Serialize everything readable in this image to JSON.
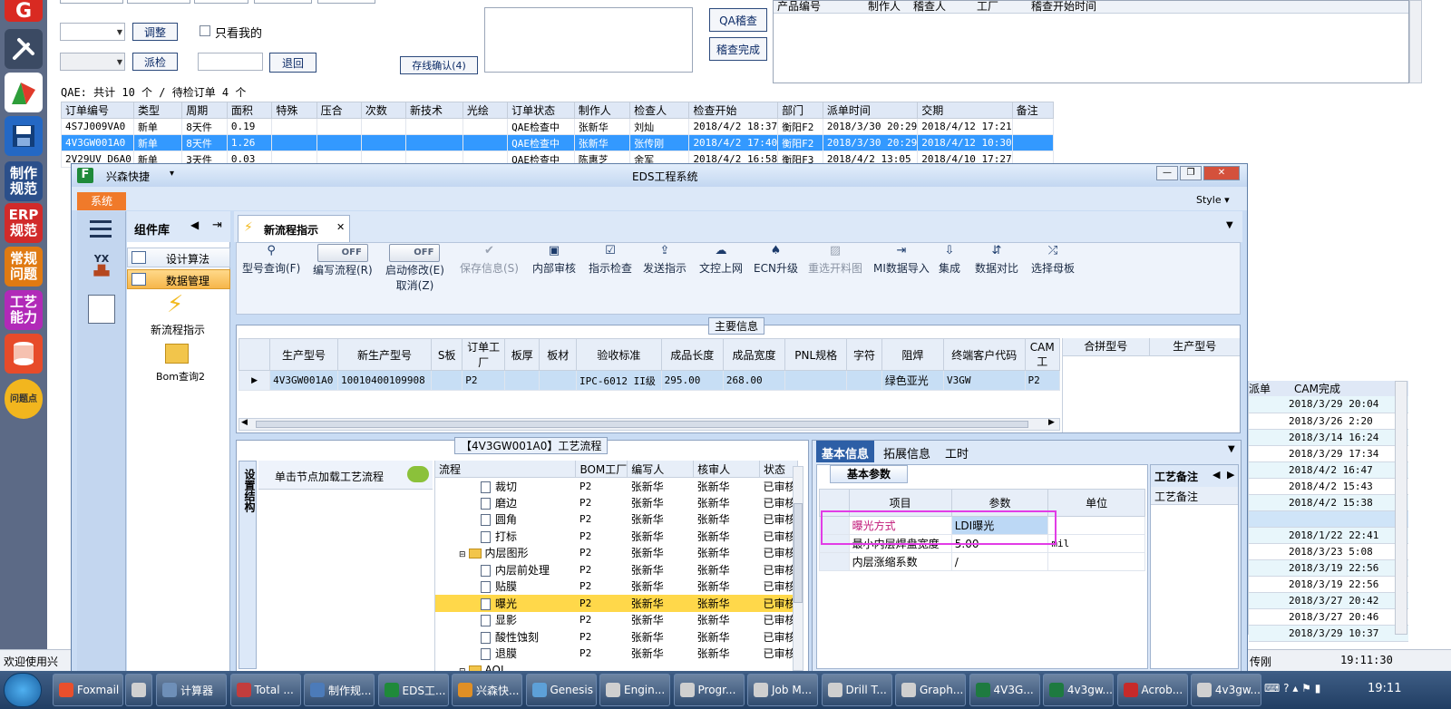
{
  "launcher": {
    "items": [
      {
        "label": "制作\n规范",
        "color": "#2b4f8a"
      },
      {
        "label": "ERP\n规范",
        "color": "#d12a2a"
      },
      {
        "label": "常规\n问题",
        "color": "#e07a12"
      },
      {
        "label": "工艺\n能力",
        "color": "#b12ab8"
      },
      {
        "label": "问题点",
        "color": "#f2b61e"
      }
    ]
  },
  "bg": {
    "toolbar": {
      "adjust_label": "调整",
      "only_mine_label": "只看我的",
      "dispatch_label": "派检",
      "return_label": "退回",
      "stock_confirm_label": "存线确认(4)",
      "qa_check_label": "QA稽查",
      "check_done_label": "稽查完成"
    },
    "qa_grid_headers": [
      "产品编号",
      "制作人",
      "稽查人",
      "工厂",
      "稽查开始时间"
    ],
    "summary": "QAE: 共计 10 个 / 待检订单 4 个",
    "orders": {
      "headers": [
        "订单编号",
        "类型",
        "周期",
        "面积",
        "特殊",
        "压合",
        "次数",
        "新技术",
        "光绘",
        "订单状态",
        "制作人",
        "检查人",
        "检查开始",
        "部门",
        "派单时间",
        "交期",
        "备注"
      ],
      "rows": [
        [
          "4S7J009VA0",
          "新单",
          "8天件",
          "0.19",
          "",
          "",
          "",
          "",
          "",
          "QAE检查中",
          "张新华",
          "刘灿",
          "2018/4/2 18:37",
          "衡阳F2",
          "2018/3/30 20:29",
          "2018/4/12 17:21",
          ""
        ],
        [
          "4V3GW001A0",
          "新单",
          "8天件",
          "1.26",
          "",
          "",
          "",
          "",
          "",
          "QAE检查中",
          "张新华",
          "张传刚",
          "2018/4/2 17:40",
          "衡阳F2",
          "2018/3/30 20:29",
          "2018/4/12 10:30",
          ""
        ],
        [
          "2V29UV D6A0",
          "新单",
          "3天件",
          "0.03",
          "",
          "",
          "",
          "",
          "",
          "QAE检查中",
          "陈惠芝",
          "余军",
          "2018/4/2 16:58",
          "衡阳F3",
          "2018/4/2 13:05",
          "2018/4/10 17:27",
          ""
        ]
      ]
    },
    "cam": {
      "header_left": "派单",
      "header": "CAM完成",
      "values": [
        "2018/3/29 20:04",
        "2018/3/26 2:20",
        "2018/3/14 16:24",
        "2018/3/29 17:34",
        "2018/4/2 16:47",
        "2018/4/2 15:43",
        "2018/4/2 15:38",
        "",
        "2018/1/22 22:41",
        "2018/3/23 5:08",
        "2018/3/19 22:56",
        "2018/3/19 22:56",
        "2018/3/27 20:42",
        "2018/3/27 20:46",
        "2018/3/29 10:37"
      ]
    },
    "status_left": "欢迎使用兴",
    "status_right_name": "传刚",
    "status_time": "19:11:30"
  },
  "eds": {
    "app_name": "兴森快捷",
    "title": "EDS工程系统",
    "system_tab": "系统",
    "style_label": "Style",
    "sidebar": {
      "component_lib": "组件库",
      "design_algo": "设计算法",
      "data_mgmt": "数据管理",
      "new_flow": "新流程指示",
      "bom_query": "Bom查询2"
    },
    "doc_tab": "新流程指示",
    "toolbar": [
      {
        "label": "型号查询(F)",
        "icon": "search-icon",
        "glyph": "⚲"
      },
      {
        "label": "编写流程(R)",
        "icon": "toggle",
        "toggle": "OFF"
      },
      {
        "label": "启动修改(E)",
        "sub": "取消(Z)",
        "icon": "toggle",
        "toggle": "OFF"
      },
      {
        "label": "保存信息(S)",
        "icon": "check-icon",
        "glyph": "✔",
        "disabled": true
      },
      {
        "label": "内部审核",
        "icon": "printer-icon",
        "glyph": "▣"
      },
      {
        "label": "指示检查",
        "icon": "checkbox-icon",
        "glyph": "☑"
      },
      {
        "label": "发送指示",
        "icon": "upload-icon",
        "glyph": "⇪"
      },
      {
        "label": "文控上网",
        "icon": "cloud-upload-icon",
        "glyph": "☁"
      },
      {
        "label": "ECN升级",
        "icon": "ecn-icon",
        "glyph": "♠"
      },
      {
        "label": "重选开料图",
        "icon": "image-icon",
        "glyph": "▨",
        "disabled": true
      },
      {
        "label": "MI数据导入",
        "icon": "import-icon",
        "glyph": "⇥"
      },
      {
        "label": "集成",
        "icon": "download-icon",
        "glyph": "⇩"
      },
      {
        "label": "数据对比",
        "icon": "compare-icon",
        "glyph": "⇵"
      },
      {
        "label": "选择母板",
        "icon": "shuffle-icon",
        "glyph": "⤮"
      }
    ],
    "main_info": {
      "legend": "主要信息",
      "headers": [
        "生产型号",
        "新生产型号",
        "S板",
        "订单工厂",
        "板厚",
        "板材",
        "验收标准",
        "成品长度",
        "成品宽度",
        "PNL规格",
        "字符",
        "阻焊",
        "终端客户代码",
        "CAM工"
      ],
      "row": [
        "4V3GW001A0",
        "10010400109908",
        "",
        "P2",
        "",
        "",
        "IPC-6012 II级",
        "295.00",
        "268.00",
        "",
        "",
        "绿色亚光",
        "V3GW",
        "P2"
      ],
      "merge_headers": [
        "合拼型号",
        "生产型号"
      ]
    },
    "flow": {
      "legend": "【4V3GW001A0】工艺流程",
      "side_tab": "设置结构",
      "load_hint": "单击节点加载工艺流程",
      "headers": [
        "流程",
        "BOM工厂",
        "编写人",
        "核审人",
        "状态"
      ],
      "rows": [
        {
          "name": "裁切",
          "type": "file",
          "indent": 2,
          "factory": "P2",
          "writer": "张新华",
          "reviewer": "张新华",
          "status": "已审核"
        },
        {
          "name": "磨边",
          "type": "file",
          "indent": 2,
          "factory": "P2",
          "writer": "张新华",
          "reviewer": "张新华",
          "status": "已审核"
        },
        {
          "name": "圆角",
          "type": "file",
          "indent": 2,
          "factory": "P2",
          "writer": "张新华",
          "reviewer": "张新华",
          "status": "已审核"
        },
        {
          "name": "打标",
          "type": "file",
          "indent": 2,
          "factory": "P2",
          "writer": "张新华",
          "reviewer": "张新华",
          "status": "已审核"
        },
        {
          "name": "内层图形",
          "type": "folder",
          "indent": 1,
          "factory": "P2",
          "writer": "张新华",
          "reviewer": "张新华",
          "status": "已审核"
        },
        {
          "name": "内层前处理",
          "type": "file",
          "indent": 2,
          "factory": "P2",
          "writer": "张新华",
          "reviewer": "张新华",
          "status": "已审核"
        },
        {
          "name": "贴膜",
          "type": "file",
          "indent": 2,
          "factory": "P2",
          "writer": "张新华",
          "reviewer": "张新华",
          "status": "已审核"
        },
        {
          "name": "曝光",
          "type": "file",
          "indent": 2,
          "factory": "P2",
          "writer": "张新华",
          "reviewer": "张新华",
          "status": "已审核",
          "selected": true
        },
        {
          "name": "显影",
          "type": "file",
          "indent": 2,
          "factory": "P2",
          "writer": "张新华",
          "reviewer": "张新华",
          "status": "已审核"
        },
        {
          "name": "酸性蚀刻",
          "type": "file",
          "indent": 2,
          "factory": "P2",
          "writer": "张新华",
          "reviewer": "张新华",
          "status": "已审核"
        },
        {
          "name": "退膜",
          "type": "file",
          "indent": 2,
          "factory": "P2",
          "writer": "张新华",
          "reviewer": "张新华",
          "status": "已审核"
        },
        {
          "name": "AOI",
          "type": "folder",
          "indent": 1,
          "factory": "",
          "writer": "",
          "reviewer": "",
          "status": ""
        }
      ]
    },
    "params": {
      "tabs": [
        "基本信息",
        "拓展信息",
        "工时"
      ],
      "subtab": "基本参数",
      "headers": [
        "项目",
        "参数",
        "单位"
      ],
      "rows": [
        {
          "item": "曝光方式",
          "value": "LDI曝光",
          "unit": ""
        },
        {
          "item": "最小内层焊盘宽度",
          "value": "5.00",
          "unit": "mil"
        },
        {
          "item": "内层涨缩系数",
          "value": "/",
          "unit": ""
        }
      ],
      "note_tab": "工艺备注",
      "note_header": "工艺备注"
    }
  },
  "taskbar": {
    "items": [
      "Foxmail",
      "",
      "计算器",
      "Total ...",
      "制作规...",
      "EDS工...",
      "兴森快...",
      "Genesis",
      "Engin...",
      "Progr...",
      "Job M...",
      "Drill T...",
      "Graph...",
      "4V3G...",
      "4v3gw...",
      "Acrob...",
      "4v3gw..."
    ],
    "clock": "19:11"
  }
}
